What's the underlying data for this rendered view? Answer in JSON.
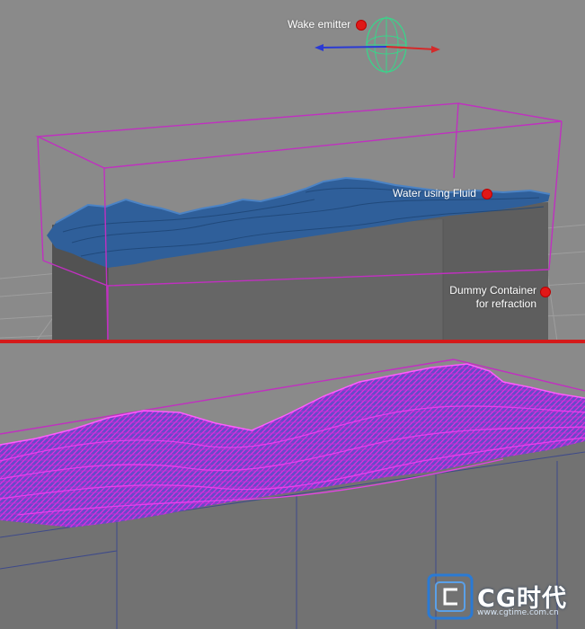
{
  "callouts": {
    "wake_emitter": "Wake emitter",
    "water_fluid": "Water using Fluid",
    "dummy_container_line1": "Dummy Container",
    "dummy_container_line2": "for refraction"
  },
  "watermark": {
    "brand": "CG时代",
    "url": "www.cgtime.com.cn"
  },
  "colors": {
    "viewport_bg": "#8a8a8a",
    "grid_line": "#9e9e9e",
    "container_wire": "#c030c0",
    "water_surface": "#2f5f9a",
    "wireframe_mesh": "#e030e0",
    "callout_dot": "#e01818",
    "panel_divider": "#d41a1a",
    "emitter_gizmo": "#3ad48a",
    "axis_x": "#d42a2a",
    "axis_z": "#2a3ad4"
  },
  "icons": {
    "emitter": "wake-emitter-gizmo-icon",
    "logo": "cgtime-logo-icon"
  }
}
